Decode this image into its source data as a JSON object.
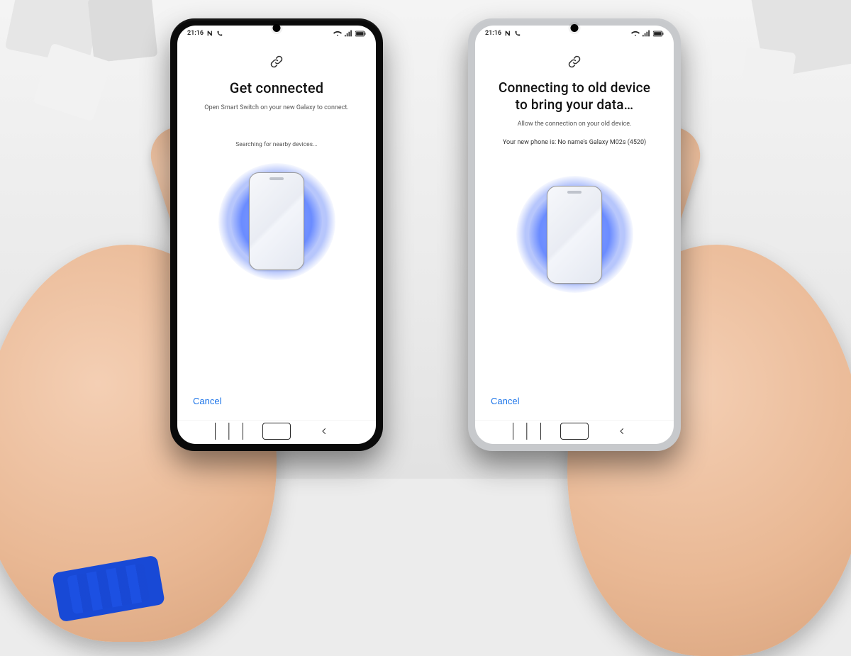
{
  "statusbar": {
    "time": "21:16"
  },
  "left_phone": {
    "title": "Get connected",
    "subtitle": "Open Smart Switch on your new Galaxy to connect.",
    "searching": "Searching for nearby devices...",
    "cancel": "Cancel"
  },
  "right_phone": {
    "title": "Connecting to old device to bring your data…",
    "subtitle": "Allow the connection on your old device.",
    "device_info": "Your new phone is: No name's Galaxy M02s (4520)",
    "cancel": "Cancel"
  }
}
